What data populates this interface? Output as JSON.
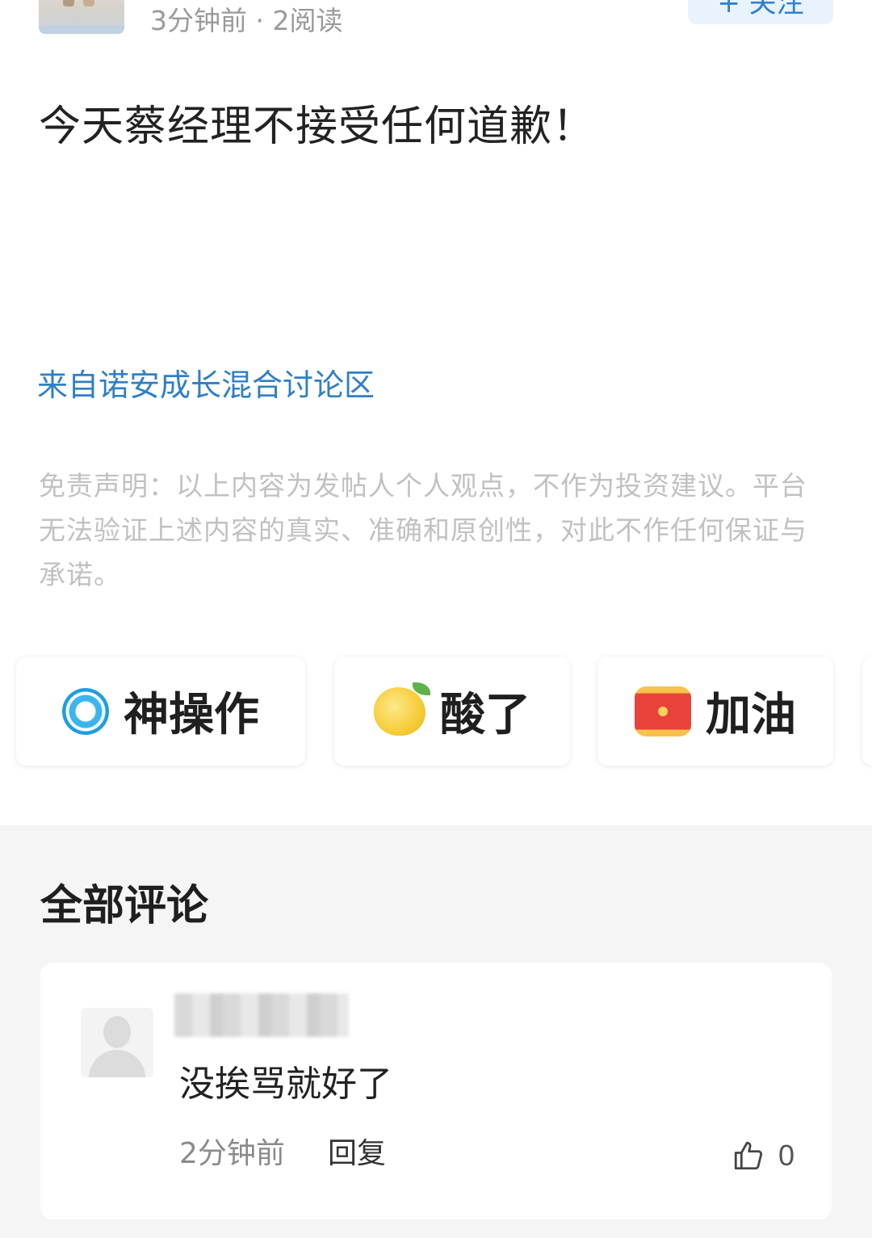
{
  "post": {
    "meta": "3分钟前 · 2阅读",
    "follow_label": "+ 关注",
    "title": "今天蔡经理不接受任何道歉！",
    "source": "来自诺安成长混合讨论区",
    "disclaimer": "免责声明：以上内容为发帖人个人观点，不作为投资建议。平台无法验证上述内容的真实、准确和原创性，对此不作任何保证与承诺。"
  },
  "reactions": [
    {
      "label": "神操作",
      "icon": "target-icon"
    },
    {
      "label": "酸了",
      "icon": "lemon-icon"
    },
    {
      "label": "加油",
      "icon": "drum-icon"
    }
  ],
  "comments": {
    "heading": "全部评论",
    "items": [
      {
        "text": "没挨骂就好了",
        "time": "2分钟前",
        "reply_label": "回复",
        "likes": "0"
      }
    ]
  }
}
